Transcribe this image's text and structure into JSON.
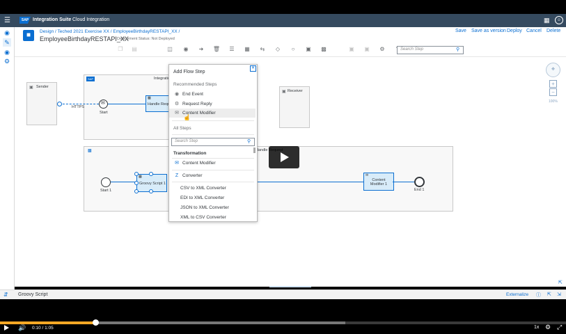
{
  "shell": {
    "brand": "SAP",
    "product": "Integration Suite",
    "app": "Cloud Integration"
  },
  "header": {
    "breadcrumb": "Design / Teched 2021 Exercise XX / EmployeeBirthdayRESTAPI_XX /",
    "title": "EmployeeBirthdayRESTAPI_XX",
    "status": "Deployment Status: Not Deployed",
    "actions": [
      "Save",
      "Save as version",
      "Deploy",
      "Cancel",
      "Delete"
    ],
    "search_placeholder": "Search Step"
  },
  "canvas": {
    "sender": "Sender",
    "receiver": "Receiver",
    "integration_process": "Integration Process",
    "https": "HTTPS",
    "start": "Start",
    "handle_request": "Handle Request",
    "local_process": "Handle Request",
    "start1": "Start 1",
    "groovy": "Groovy Script 1",
    "content_modifier": "Content Modifier 1",
    "end1": "End 1",
    "zoom": "100%"
  },
  "popup": {
    "title": "Add Flow Step",
    "recommended_heading": "Recommended Steps",
    "recommended": [
      {
        "icon": "end-event-icon",
        "label": "End Event"
      },
      {
        "icon": "request-reply-icon",
        "label": "Request Reply"
      },
      {
        "icon": "envelope-icon",
        "label": "Content Modifier"
      }
    ],
    "all_heading": "All Steps",
    "search_placeholder": "Search Step",
    "transformation_heading": "Transformation",
    "transformation": [
      {
        "icon": "envelope-icon",
        "label": "Content Modifier"
      },
      {
        "icon": "converter-icon",
        "label": "Converter"
      },
      {
        "icon": "",
        "label": "CSV to XML Converter"
      },
      {
        "icon": "",
        "label": "EDI to XML Converter"
      },
      {
        "icon": "",
        "label": "JSON to XML Converter"
      },
      {
        "icon": "",
        "label": "XML to CSV Converter"
      }
    ]
  },
  "bottom": {
    "title": "Groovy Script",
    "externalize": "Externalize"
  },
  "player": {
    "current_time": "0:10",
    "duration": "1:05",
    "time_display": "0:10 / 1:05",
    "progress": 0.168,
    "buffered": 0.61,
    "speed": "1x",
    "accent_color": "#f9a825"
  },
  "colors": {
    "shell": "#354a5f",
    "accent": "#0a6ed1"
  }
}
